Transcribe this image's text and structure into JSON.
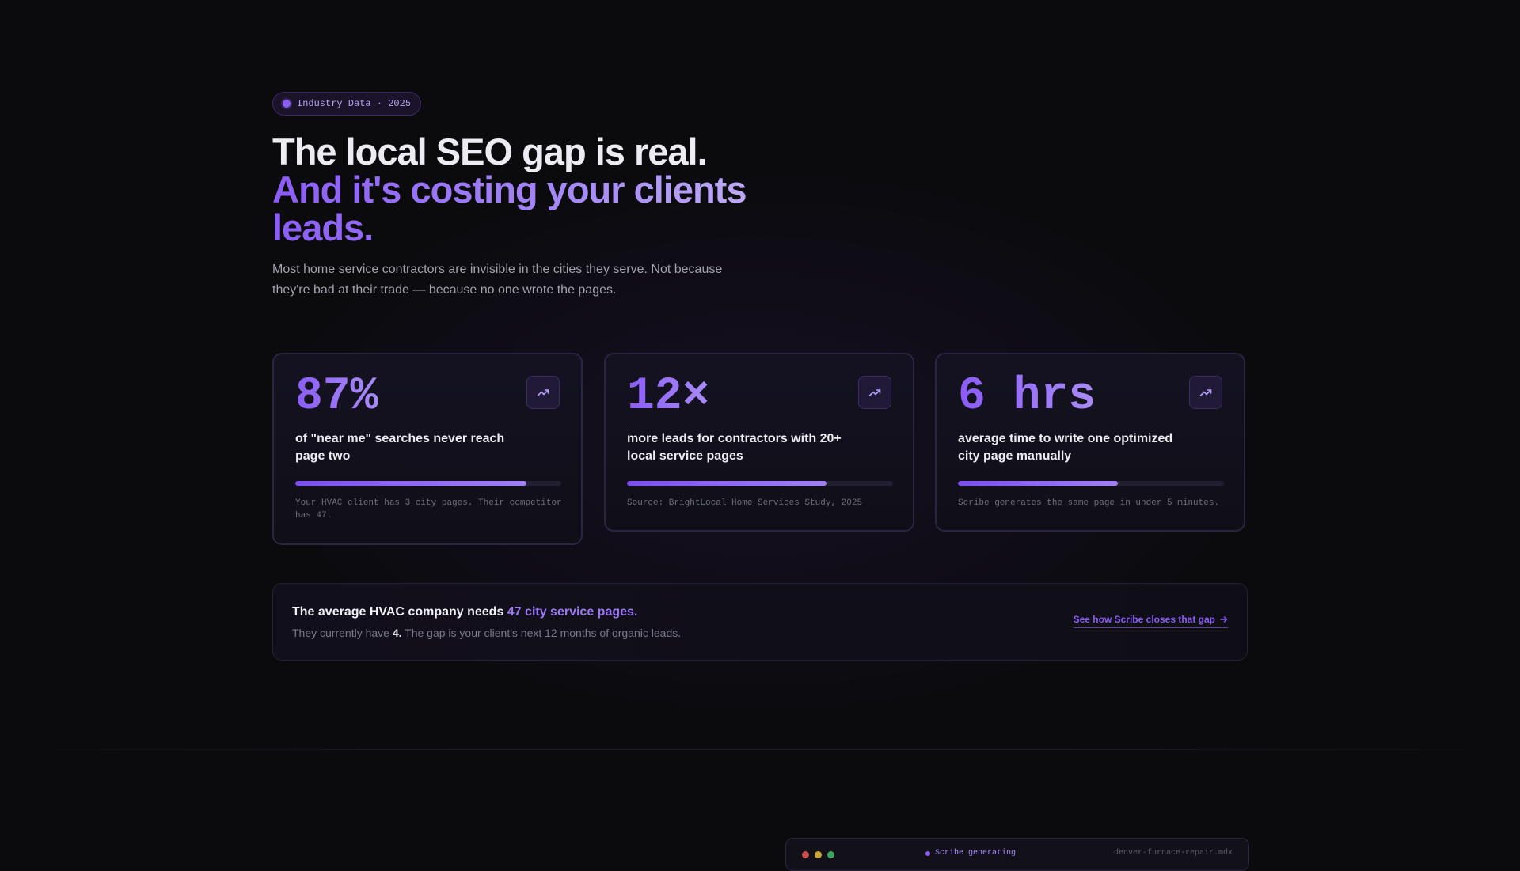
{
  "badge": {
    "label": "Industry Data · 2025"
  },
  "hero": {
    "headline_line1": "The local SEO gap is real.",
    "headline_line2": "And it's costing your clients leads.",
    "subtext": "Most home service contractors are invisible in the cities they serve. Not because they're bad at their trade — because no one wrote the pages."
  },
  "stats": [
    {
      "value": "87%",
      "label": "of \"near me\" searches never reach page two",
      "progress_percent": 87,
      "note": "Your HVAC client has 3 city pages. Their competitor has 47.",
      "icon": "trend-up-icon"
    },
    {
      "value": "12×",
      "label": "more leads for contractors with 20+ local service pages",
      "progress_percent": 75,
      "note": "Source: BrightLocal Home Services Study, 2025",
      "icon": "trend-up-icon"
    },
    {
      "value": "6 hrs",
      "label": "average time to write one optimized city page manually",
      "progress_percent": 60,
      "note": "Scribe generates the same page in under 5 minutes.",
      "icon": "trend-up-icon"
    }
  ],
  "callout": {
    "title_prefix": "The average HVAC company needs ",
    "title_highlight": "47 city service pages.",
    "sub_prefix": "They currently have ",
    "sub_bold": "4.",
    "sub_suffix": " The gap is your client's next 12 months of organic leads.",
    "link_label": "See how Scribe closes that gap",
    "link_icon": "arrow-right-icon"
  },
  "preview_window": {
    "status": "Scribe generating",
    "file_name": "denver-furnace-repair.mdx"
  },
  "colors": {
    "accent": "#8b5cf6",
    "background": "#0b0b0e",
    "card_border": "#2a2540"
  }
}
